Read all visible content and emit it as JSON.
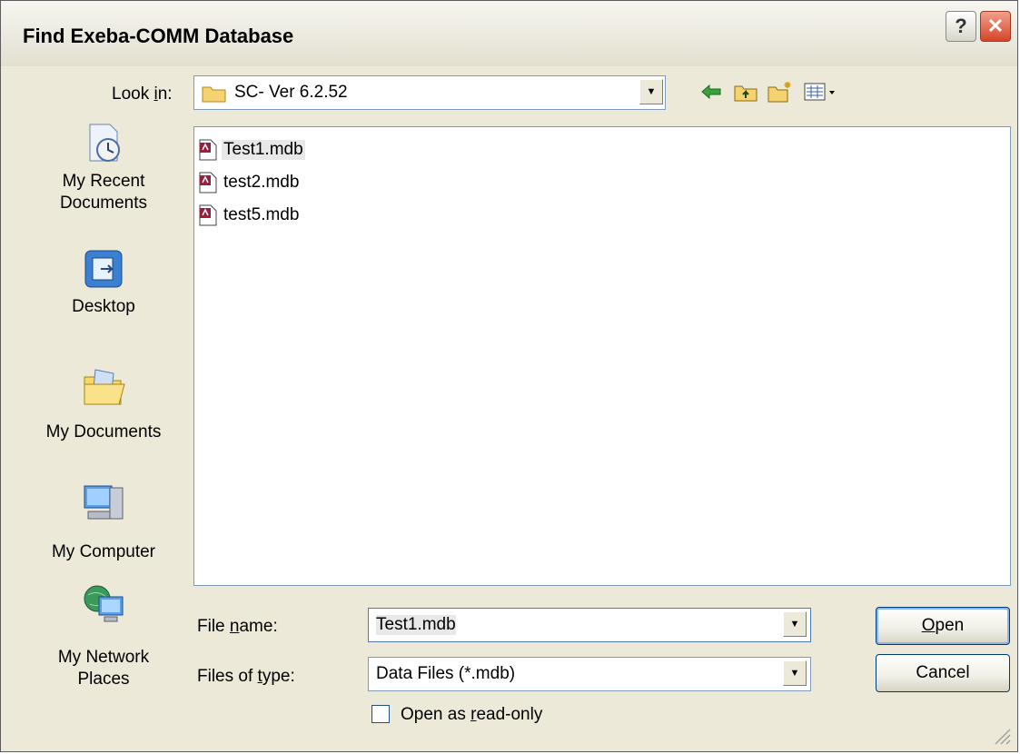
{
  "window": {
    "title": "Find Exeba-COMM Database"
  },
  "titlebar_buttons": {
    "help": "?",
    "close": "✕"
  },
  "lookin": {
    "label_pre": "Look ",
    "label_ul": "i",
    "label_post": "n:",
    "value": "SC- Ver 6.2.52"
  },
  "toolbar": {
    "icons": [
      "back-icon",
      "up-folder-icon",
      "new-folder-icon",
      "view-menu-icon"
    ]
  },
  "places": [
    {
      "label": "My Recent Documents",
      "icon": "recent-documents-icon"
    },
    {
      "label": "Desktop",
      "icon": "desktop-icon"
    },
    {
      "label": "My Documents",
      "icon": "my-documents-icon"
    },
    {
      "label": "My Computer",
      "icon": "my-computer-icon"
    },
    {
      "label": "My Network Places",
      "icon": "network-places-icon"
    }
  ],
  "files": [
    {
      "name": "Test1.mdb",
      "selected": true
    },
    {
      "name": "test2.mdb",
      "selected": false
    },
    {
      "name": "test5.mdb",
      "selected": false
    }
  ],
  "filename": {
    "label_pre": "File ",
    "label_ul": "n",
    "label_post": "ame:",
    "value": "Test1.mdb"
  },
  "filetype": {
    "label_pre": "Files of ",
    "label_ul": "t",
    "label_post": "ype:",
    "value": "Data Files (*.mdb)"
  },
  "readonly": {
    "label_pre": "Open as ",
    "label_ul": "r",
    "label_post": "ead-only",
    "checked": false
  },
  "buttons": {
    "open_ul": "O",
    "open_rest": "pen",
    "cancel": "Cancel"
  },
  "colors": {
    "titlebar": "#ece9d8",
    "close": "#d6452a",
    "border": "#7f9db9"
  }
}
